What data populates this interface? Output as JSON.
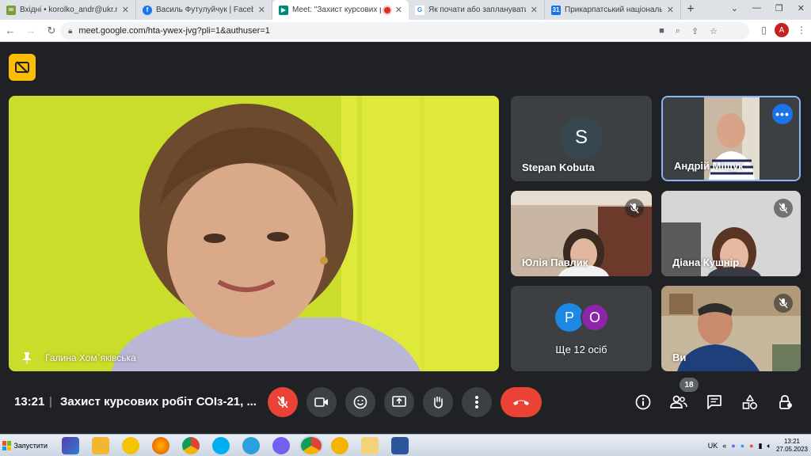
{
  "browser": {
    "tabs": [
      {
        "title": "Вхідні • korolko_andr@ukr.net",
        "favicon": "gmail-icon",
        "color": "#7b9e3a"
      },
      {
        "title": "Василь Футулуйчук | Facebook",
        "favicon": "facebook-icon",
        "color": "#1877f2"
      },
      {
        "title": "Meet: \"Захист курсових р",
        "favicon": "meet-icon",
        "color": "#00897b"
      },
      {
        "title": "Як почати або запланувати в",
        "favicon": "google-icon",
        "color": "#4285f4"
      },
      {
        "title": "Прикарпатський національн",
        "favicon": "calendar-icon",
        "color": "#1a73e8"
      }
    ],
    "url": "meet.google.com/hta-ywex-jvg?pli=1&authuser=1",
    "profile_initial": "A"
  },
  "meet": {
    "main_speaker": "Галина Хом`яківська",
    "participants": [
      {
        "name": "Stepan Kobuta",
        "avatar_letter": "S"
      },
      {
        "name": "Андрій Міщук"
      },
      {
        "name": "Юлія Павлик"
      },
      {
        "name": "Діана Кушнір"
      },
      {
        "name": "Ще 12 осіб",
        "avatars": [
          "P",
          "O"
        ]
      },
      {
        "name": "Ви"
      }
    ],
    "time": "13:21",
    "separator": "|",
    "meeting_title": "Захист курсових робіт СОІз-21, ...",
    "people_count": "18"
  },
  "taskbar": {
    "start_label": "Запустити",
    "language": "UK",
    "clock_time": "13:21",
    "clock_date": "27.05.2023"
  },
  "colors": {
    "meet_bg": "#202124",
    "tile_bg": "#3c4043",
    "accent_blue": "#1a73e8",
    "mic_red": "#ea4335",
    "caption_yellow": "#fbbc04"
  }
}
